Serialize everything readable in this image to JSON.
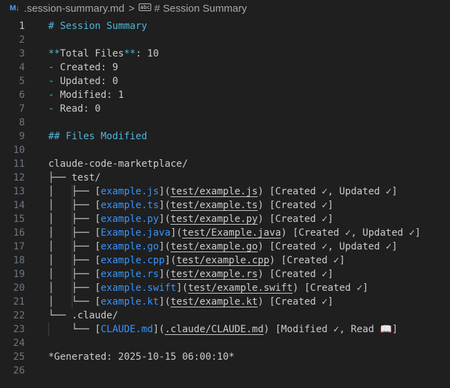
{
  "breadcrumb": {
    "md_icon": "M↓",
    "file": ".session-summary.md",
    "separator": ">",
    "abc_icon": "abc",
    "symbol": "# Session Summary"
  },
  "editor": {
    "active_line": 1,
    "lines": [
      {
        "n": "1",
        "segs": [
          [
            "hdr",
            "# Session Summary"
          ]
        ]
      },
      {
        "n": "2",
        "segs": []
      },
      {
        "n": "3",
        "segs": [
          [
            "bold-mark",
            "**"
          ],
          [
            "txt",
            "Total Files"
          ],
          [
            "bold-mark",
            "**"
          ],
          [
            "txt",
            ": 10"
          ]
        ]
      },
      {
        "n": "4",
        "segs": [
          [
            "lt",
            "- "
          ],
          [
            "txt",
            "Created: 9"
          ]
        ]
      },
      {
        "n": "5",
        "segs": [
          [
            "lt",
            "- "
          ],
          [
            "txt",
            "Updated: 0"
          ]
        ]
      },
      {
        "n": "6",
        "segs": [
          [
            "lt",
            "- "
          ],
          [
            "txt",
            "Modified: 1"
          ]
        ]
      },
      {
        "n": "7",
        "segs": [
          [
            "lt",
            "- "
          ],
          [
            "txt",
            "Read: 0"
          ]
        ]
      },
      {
        "n": "8",
        "segs": []
      },
      {
        "n": "9",
        "segs": [
          [
            "hdr",
            "## Files Modified"
          ]
        ]
      },
      {
        "n": "10",
        "segs": []
      },
      {
        "n": "11",
        "segs": [
          [
            "txt",
            "claude-code-marketplace/"
          ]
        ]
      },
      {
        "n": "12",
        "segs": [
          [
            "txt",
            "├── test/"
          ]
        ]
      },
      {
        "n": "13",
        "segs": [
          [
            "txt",
            "│   ├── ["
          ],
          [
            "lnk",
            "example.js"
          ],
          [
            "txt",
            "]("
          ],
          [
            "url",
            "test/example.js"
          ],
          [
            "txt",
            ") [Created ✓, Updated ✓]"
          ]
        ]
      },
      {
        "n": "14",
        "segs": [
          [
            "txt",
            "│   ├── ["
          ],
          [
            "lnk",
            "example.ts"
          ],
          [
            "txt",
            "]("
          ],
          [
            "url",
            "test/example.ts"
          ],
          [
            "txt",
            ") [Created ✓]"
          ]
        ]
      },
      {
        "n": "15",
        "segs": [
          [
            "txt",
            "│   ├── ["
          ],
          [
            "lnk",
            "example.py"
          ],
          [
            "txt",
            "]("
          ],
          [
            "url",
            "test/example.py"
          ],
          [
            "txt",
            ") [Created ✓]"
          ]
        ]
      },
      {
        "n": "16",
        "segs": [
          [
            "txt",
            "│   ├── ["
          ],
          [
            "lnk",
            "Example.java"
          ],
          [
            "txt",
            "]("
          ],
          [
            "url",
            "test/Example.java"
          ],
          [
            "txt",
            ") [Created ✓, Updated ✓]"
          ]
        ]
      },
      {
        "n": "17",
        "segs": [
          [
            "txt",
            "│   ├── ["
          ],
          [
            "lnk",
            "example.go"
          ],
          [
            "txt",
            "]("
          ],
          [
            "url",
            "test/example.go"
          ],
          [
            "txt",
            ") [Created ✓, Updated ✓]"
          ]
        ]
      },
      {
        "n": "18",
        "segs": [
          [
            "txt",
            "│   ├── ["
          ],
          [
            "lnk",
            "example.cpp"
          ],
          [
            "txt",
            "]("
          ],
          [
            "url",
            "test/example.cpp"
          ],
          [
            "txt",
            ") [Created ✓]"
          ]
        ]
      },
      {
        "n": "19",
        "segs": [
          [
            "txt",
            "│   ├── ["
          ],
          [
            "lnk",
            "example.rs"
          ],
          [
            "txt",
            "]("
          ],
          [
            "url",
            "test/example.rs"
          ],
          [
            "txt",
            ") [Created ✓]"
          ]
        ]
      },
      {
        "n": "20",
        "segs": [
          [
            "txt",
            "│   ├── ["
          ],
          [
            "lnk",
            "example.swift"
          ],
          [
            "txt",
            "]("
          ],
          [
            "url",
            "test/example.swift"
          ],
          [
            "txt",
            ") [Created ✓]"
          ]
        ]
      },
      {
        "n": "21",
        "segs": [
          [
            "txt",
            "│   └── ["
          ],
          [
            "lnk",
            "example.kt"
          ],
          [
            "txt",
            "]("
          ],
          [
            "url",
            "test/example.kt"
          ],
          [
            "txt",
            ") [Created ✓]"
          ]
        ]
      },
      {
        "n": "22",
        "segs": [
          [
            "txt",
            "└── .claude/"
          ]
        ]
      },
      {
        "n": "23",
        "segs": [
          [
            "txt",
            "    └── ["
          ],
          [
            "lnk",
            "CLAUDE.md"
          ],
          [
            "txt",
            "]("
          ],
          [
            "url",
            ".claude/CLAUDE.md"
          ],
          [
            "txt",
            ") [Modified ✓, Read 📖]"
          ]
        ]
      },
      {
        "n": "24",
        "segs": []
      },
      {
        "n": "25",
        "segs": [
          [
            "txt",
            "*Generated: 2025-10-15 06:00:10*"
          ]
        ]
      },
      {
        "n": "26",
        "segs": []
      }
    ]
  }
}
